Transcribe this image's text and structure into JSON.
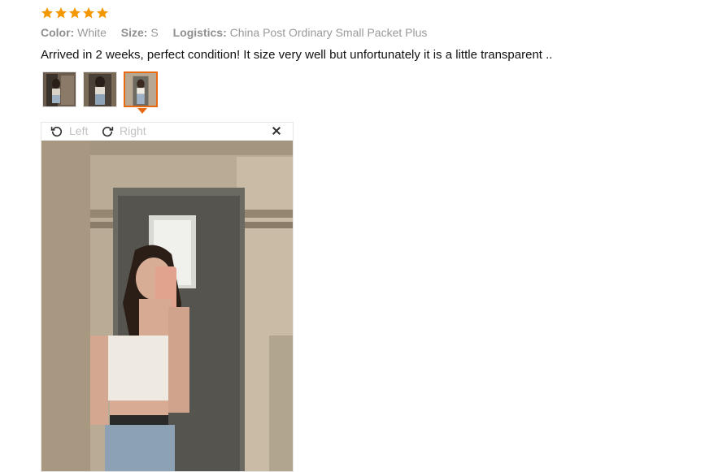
{
  "rating": {
    "stars": 5,
    "max": 5,
    "color": "#f39800"
  },
  "attributes": {
    "color_label": "Color:",
    "color_value": "White",
    "size_label": "Size:",
    "size_value": "S",
    "logistics_label": "Logistics:",
    "logistics_value": "China Post Ordinary Small Packet Plus"
  },
  "review_text": "Arrived in 2 weeks, perfect condition! It size very well but unfortunately it is a little transparent ..",
  "thumbnails": {
    "count": 3,
    "selected_index": 2,
    "accent": "#e76a12"
  },
  "viewer": {
    "rotate_left_label": "Left",
    "rotate_right_label": "Right",
    "icons": [
      "rotate-left-icon",
      "rotate-right-icon",
      "close-icon"
    ]
  }
}
